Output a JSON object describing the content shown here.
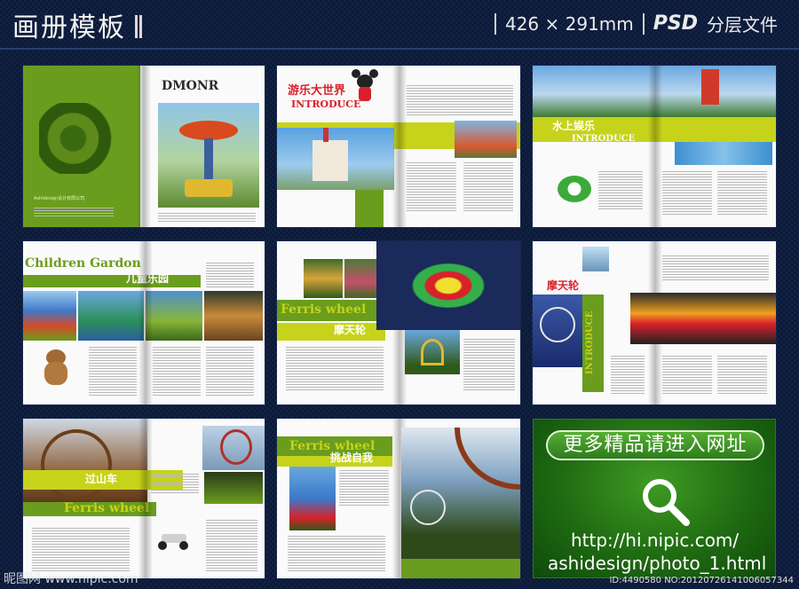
{
  "header": {
    "title": "画册模板",
    "size": "426 × 291mm",
    "format": "PSD",
    "subtitle": "分层文件"
  },
  "spreads": {
    "s1": {
      "heading": "DMONR",
      "company": "Ashidesign设计有限公司"
    },
    "s2": {
      "cn_title": "游乐大世界",
      "en_title": "INTRODUCE"
    },
    "s3": {
      "cn_title": "水上娱乐",
      "en_title": "INTRODUCE"
    },
    "s4": {
      "en_title": "Children Gardon",
      "cn_title": "儿童乐园"
    },
    "s5": {
      "en_title": "Ferris wheel",
      "cn_title": "摩天轮"
    },
    "s6": {
      "cn_title": "摩天轮",
      "en_title": "INTRODUCE"
    },
    "s7": {
      "cn_title": "过山车",
      "en_title": "Ferris wheel"
    },
    "s8": {
      "en_title": "Ferris wheel",
      "cn_title": "挑战自我"
    }
  },
  "promo": {
    "button": "更多精品请进入网址",
    "url_line1": "http://hi.nipic.com/",
    "url_line2": "ashidesign/photo_1.html",
    "icon": "magnifier-icon"
  },
  "watermark": {
    "left": "昵图网 www.nipic.com",
    "right": "ID:4490580 NO:20120726141006057344"
  }
}
